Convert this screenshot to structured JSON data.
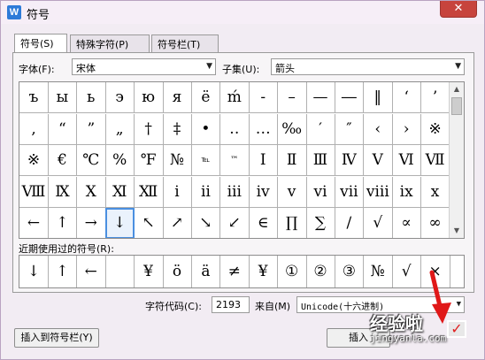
{
  "window": {
    "title": "符号",
    "app_icon": "W",
    "close_icon": "✕"
  },
  "tabs": [
    {
      "label": "符号(S)"
    },
    {
      "label": "特殊字符(P)"
    },
    {
      "label": "符号栏(T)"
    }
  ],
  "font": {
    "label": "字体(F):",
    "value": "宋体"
  },
  "subset": {
    "label": "子集(U):",
    "value": "箭头"
  },
  "symbols": [
    [
      "ъ",
      "ы",
      "ь",
      "э",
      "ю",
      "я",
      "ё",
      "ḿ",
      "-",
      "–",
      "—",
      "―",
      "‖",
      "‘",
      "’"
    ],
    [
      "‚",
      "“",
      "”",
      "„",
      "†",
      "‡",
      "•",
      "‥",
      "…",
      "‰",
      "′",
      "″",
      "‹",
      "›",
      "※"
    ],
    [
      "※",
      "€",
      "℃",
      "%",
      "℉",
      "№",
      "℡",
      "™",
      "Ⅰ",
      "Ⅱ",
      "Ⅲ",
      "Ⅳ",
      "Ⅴ",
      "Ⅵ",
      "Ⅶ"
    ],
    [
      "Ⅷ",
      "Ⅸ",
      "Ⅹ",
      "Ⅺ",
      "Ⅻ",
      "ⅰ",
      "ⅱ",
      "ⅲ",
      "ⅳ",
      "ⅴ",
      "ⅵ",
      "ⅶ",
      "ⅷ",
      "ⅸ",
      "ⅹ"
    ],
    [
      "←",
      "↑",
      "→",
      "↓",
      "↖",
      "↗",
      "↘",
      "↙",
      "∈",
      "∏",
      "∑",
      "∕",
      "√",
      "∝",
      "∞"
    ]
  ],
  "recent": {
    "label": "近期使用过的符号(R):",
    "items": [
      "↓",
      "↑",
      "←",
      "",
      "¥",
      "ö",
      "ä",
      "≠",
      "¥",
      "①",
      "②",
      "③",
      "№",
      "√",
      "×"
    ]
  },
  "charcode": {
    "label": "字符代码(C):",
    "value": "2193",
    "from_label": "来自(M)",
    "from_value": "Unicode(十六进制)"
  },
  "buttons": {
    "insert_to_bar": "插入到符号栏(Y)",
    "insert": "插入"
  },
  "watermark": {
    "main": "经验啦",
    "sub": "jingyanla.com",
    "check": "✓"
  }
}
